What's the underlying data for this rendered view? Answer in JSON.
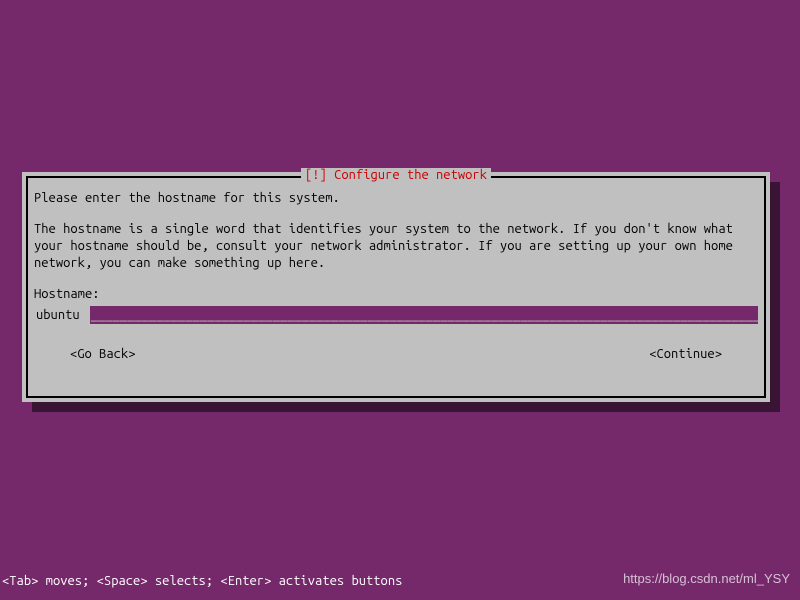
{
  "dialog": {
    "title": "[!] Configure the network",
    "instruction": "Please enter the hostname for this system.",
    "description": "The hostname is a single word that identifies your system to the network. If you don't know what your hostname should be, consult your network administrator. If you are setting up your own home network, you can make something up here.",
    "field_label": "Hostname:",
    "field_value": "ubuntu",
    "go_back": "<Go Back>",
    "continue": "<Continue>"
  },
  "footer": {
    "help_text": "<Tab> moves; <Space> selects; <Enter> activates buttons"
  },
  "watermark": "https://blog.csdn.net/ml_YSY"
}
